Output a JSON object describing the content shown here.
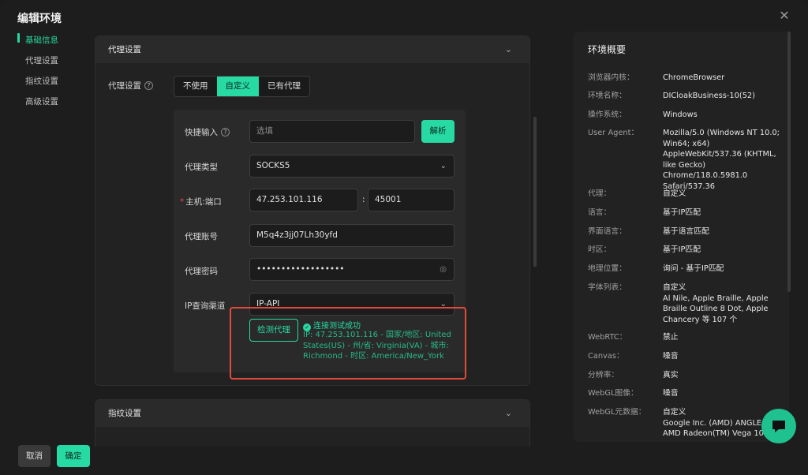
{
  "dialog": {
    "title": "编辑环境"
  },
  "nav": {
    "items": [
      {
        "label": "基础信息"
      },
      {
        "label": "代理设置"
      },
      {
        "label": "指纹设置"
      },
      {
        "label": "高级设置"
      }
    ]
  },
  "proxy_panel": {
    "header": "代理设置",
    "mode_label": "代理设置",
    "modes": [
      "不使用",
      "自定义",
      "已有代理"
    ],
    "selected_mode": "自定义",
    "quick_input": {
      "label": "快捷输入",
      "placeholder": "选填",
      "parse_button": "解析"
    },
    "proxy_type": {
      "label": "代理类型",
      "value": "SOCKS5"
    },
    "host_port": {
      "label": "主机:端口",
      "host": "47.253.101.116",
      "separator": ":",
      "port": "45001"
    },
    "account": {
      "label": "代理账号",
      "value": "M5q4z3jj07Lh30yfd"
    },
    "password": {
      "label": "代理密码",
      "value": "••••••••••••••••••"
    },
    "ip_channel": {
      "label": "IP查询渠道",
      "value": "IP-API"
    },
    "detect_button": "检测代理",
    "result_status": "连接测试成功",
    "result_detail": "IP: 47.253.101.116 - 国家/地区: United States(US) - 州/省: Virginia(VA) - 城市: Richmond - 时区: America/New_York"
  },
  "fingerprint_panel": {
    "header": "指纹设置"
  },
  "summary": {
    "title": "环境概要",
    "rows": [
      {
        "key": "浏览器内核：",
        "value": "ChromeBrowser"
      },
      {
        "key": "环境名称：",
        "value": "DICloakBusiness-10(52)"
      },
      {
        "key": "操作系统：",
        "value": "Windows"
      },
      {
        "key": "User Agent：",
        "value": "Mozilla/5.0 (Windows NT 10.0; Win64; x64) AppleWebKit/537.36 (KHTML, like Gecko) Chrome/118.0.5981.0 Safari/537.36"
      },
      {
        "key": "代理：",
        "value": "自定义"
      },
      {
        "key": "语言：",
        "value": "基于IP匹配"
      },
      {
        "key": "界面语言：",
        "value": "基于语言匹配"
      },
      {
        "key": "时区：",
        "value": "基于IP匹配"
      },
      {
        "key": "地理位置：",
        "value": "询问 - 基于IP匹配"
      },
      {
        "key": "字体列表：",
        "value": "自定义\nAl Nile, Apple Braille, Apple Braille Outline 8 Dot, Apple Chancery 等 107 个"
      },
      {
        "key": "WebRTC：",
        "value": "禁止"
      },
      {
        "key": "Canvas：",
        "value": "噪音"
      },
      {
        "key": "分辨率：",
        "value": "真实"
      },
      {
        "key": "WebGL图像：",
        "value": "噪音"
      },
      {
        "key": "WebGL元数据：",
        "value": "自定义\nGoogle Inc. (AMD) ANGLE (AMD\nAMD Radeon(TM) Vega 10"
      }
    ]
  },
  "footer": {
    "cancel": "取消",
    "confirm": "确定"
  },
  "colors": {
    "accent": "#27d9a2",
    "highlight_box": "#e24b3b"
  }
}
